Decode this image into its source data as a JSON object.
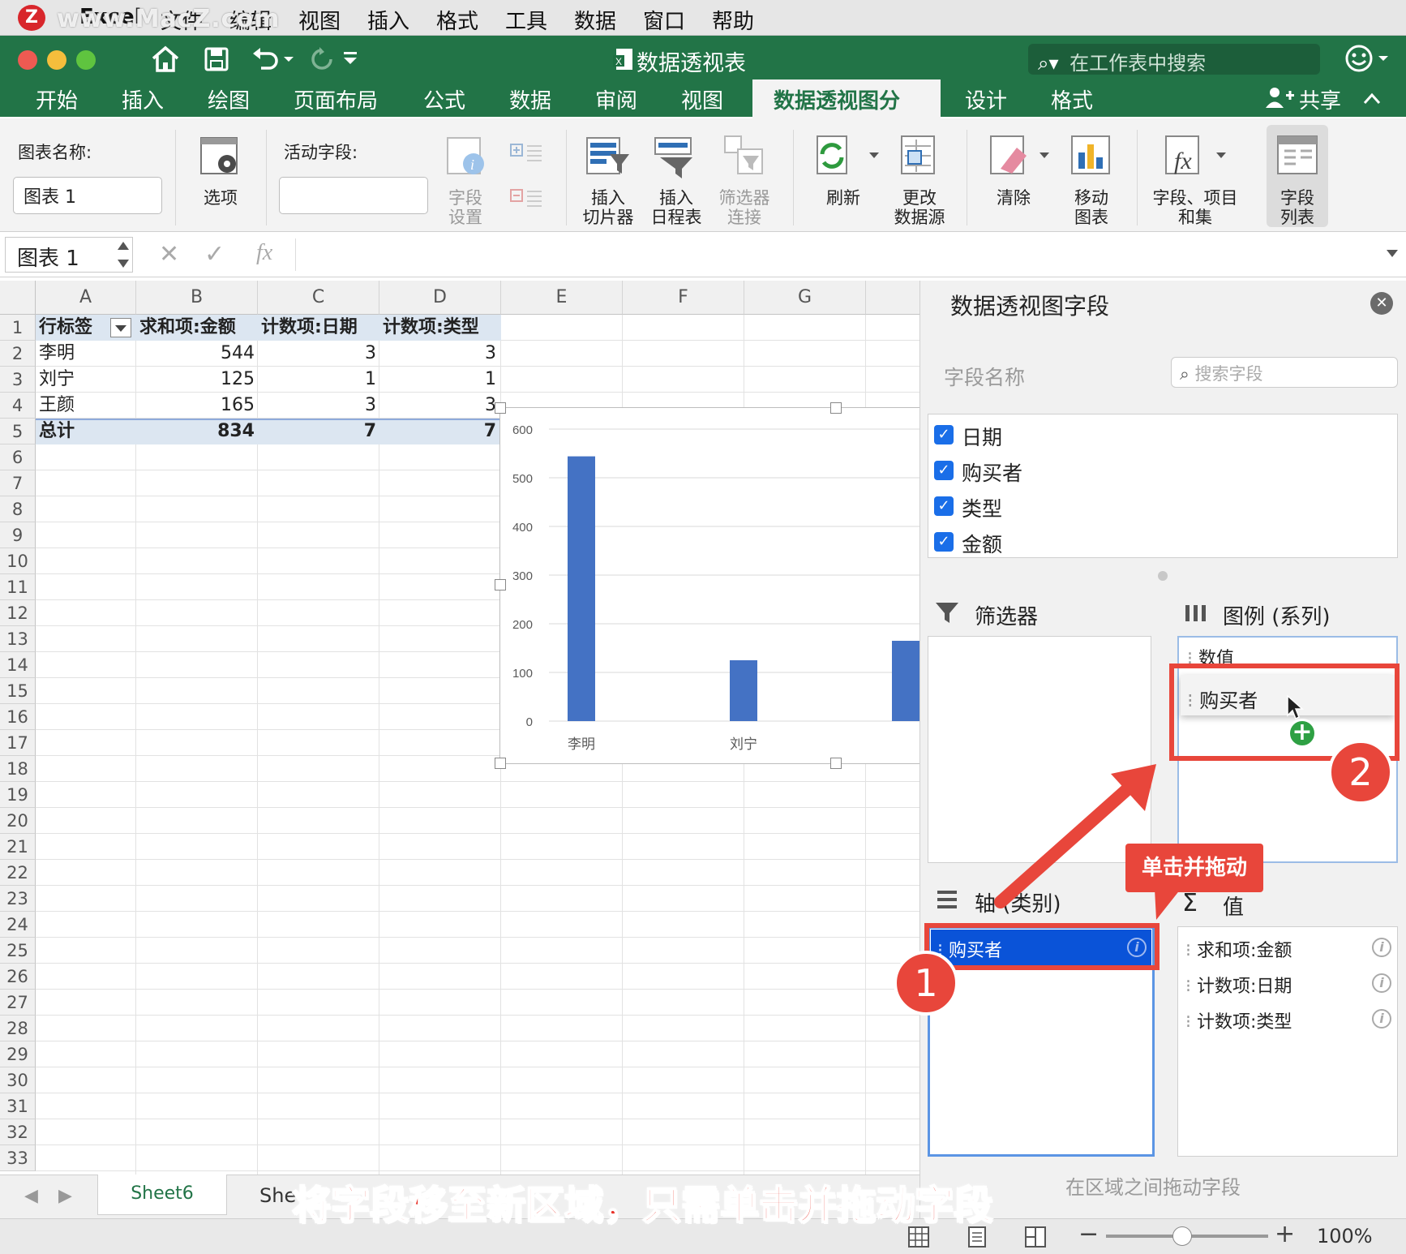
{
  "menubar": {
    "logo": "Z",
    "watermark": "www.MacZ.com",
    "items": [
      "Excel",
      "文件",
      "编辑",
      "视图",
      "插入",
      "格式",
      "工具",
      "数据",
      "窗口",
      "帮助"
    ]
  },
  "window": {
    "title": "数据透视表",
    "search_placeholder": "在工作表中搜索"
  },
  "tabs": [
    "开始",
    "插入",
    "绘图",
    "页面布局",
    "公式",
    "数据",
    "审阅",
    "视图",
    "数据透视图分析",
    "设计",
    "格式"
  ],
  "share_label": "共享",
  "ribbon": {
    "chart_name_label": "图表名称:",
    "chart_name_value": "图表 1",
    "options": "选项",
    "active_field_label": "活动字段:",
    "active_field_value": "",
    "field_settings": [
      "字段",
      "设置"
    ],
    "insert_slicer": [
      "插入",
      "切片器"
    ],
    "insert_timeline": [
      "插入",
      "日程表"
    ],
    "filter_connections": [
      "筛选器",
      "连接"
    ],
    "refresh": "刷新",
    "change_source": [
      "更改",
      "数据源"
    ],
    "clear": "清除",
    "move_chart": [
      "移动",
      "图表"
    ],
    "fields_items_sets": [
      "字段、项目",
      "和集"
    ],
    "field_list": [
      "字段",
      "列表"
    ]
  },
  "formula_bar": {
    "name_box": "图表 1",
    "fx": "fx"
  },
  "grid": {
    "columns": [
      "A",
      "B",
      "C",
      "D",
      "E",
      "F",
      "G"
    ],
    "rows": [
      "1",
      "2",
      "3",
      "4",
      "5",
      "6",
      "7",
      "8",
      "9",
      "10",
      "11",
      "12",
      "13",
      "14",
      "15",
      "16",
      "17",
      "18",
      "19",
      "20",
      "21",
      "22",
      "23",
      "24",
      "25",
      "26",
      "27",
      "28",
      "29",
      "30",
      "31",
      "32",
      "33"
    ],
    "headers": [
      "行标签",
      "求和项:金额",
      "计数项:日期",
      "计数项:类型"
    ],
    "data": [
      [
        "李明",
        "544",
        "3",
        "3"
      ],
      [
        "刘宁",
        "125",
        "1",
        "1"
      ],
      [
        "王颜",
        "165",
        "3",
        "3"
      ]
    ],
    "total": [
      "总计",
      "834",
      "7",
      "7"
    ]
  },
  "chart_data": {
    "type": "bar",
    "categories": [
      "李明",
      "刘宁",
      "王颜"
    ],
    "visible_category_labels": [
      "李明",
      "刘宁"
    ],
    "series": [
      {
        "values": [
          544,
          125,
          165
        ]
      }
    ],
    "yticks": [
      "0",
      "100",
      "200",
      "300",
      "400",
      "500",
      "600"
    ],
    "ylim": [
      0,
      600
    ],
    "color": "#4472c4",
    "grid": true
  },
  "panel": {
    "title": "数据透视图字段",
    "field_name_label": "字段名称",
    "search_placeholder": "搜索字段",
    "fields": [
      "日期",
      "购买者",
      "类型",
      "金额"
    ],
    "filter_title": "筛选器",
    "legend_title": "图例 (系列)",
    "legend_items": [
      "数值",
      "购买者"
    ],
    "axis_title": "轴 (类别)",
    "axis_items": [
      "购买者"
    ],
    "values_title": "值",
    "value_items": [
      "求和项:金额",
      "计数项:日期",
      "计数项:类型"
    ],
    "footer": "在区域之间拖动字段"
  },
  "annotations": {
    "badge1": "1",
    "badge2": "2",
    "tooltip": "单击并拖动",
    "caption": "将字段移至新区域，只需单击并拖动字段",
    "arrow_color": "#e8463b"
  },
  "sheet_tabs": [
    "Sheet6",
    "She"
  ],
  "status": {
    "zoom": "100%"
  }
}
